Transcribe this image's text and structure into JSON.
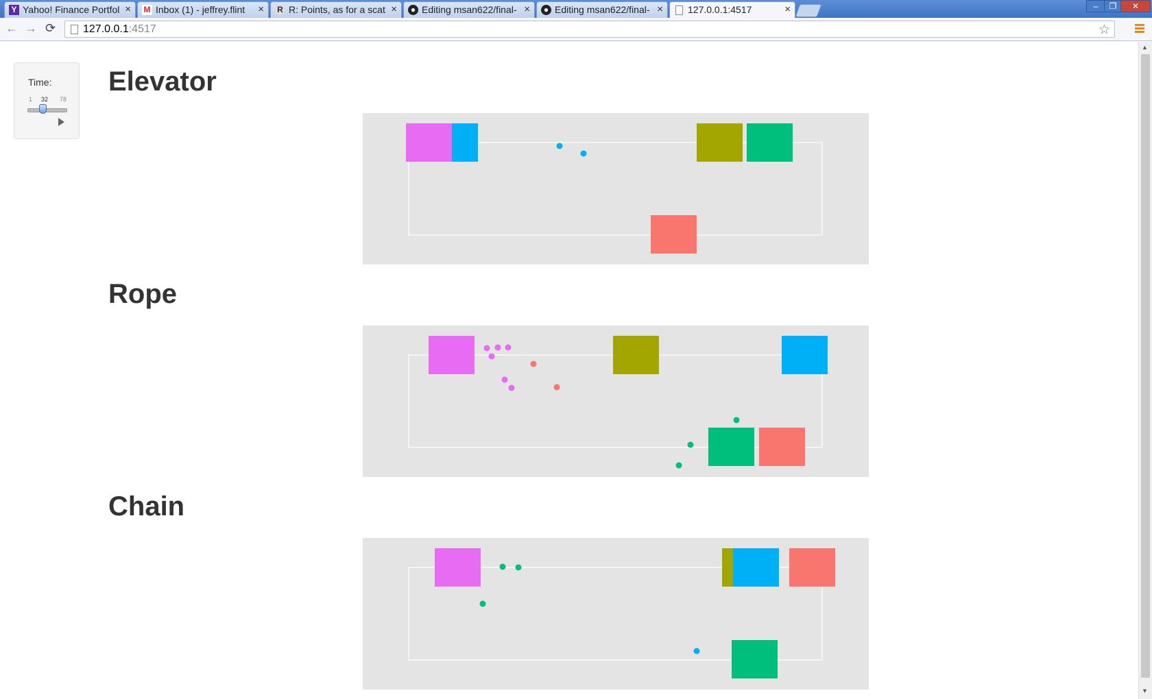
{
  "browser": {
    "tabs": [
      {
        "title": "Yahoo! Finance Portfol",
        "icon": "yahoo-icon",
        "active": false
      },
      {
        "title": "Inbox (1) - jeffrey.flint",
        "icon": "gmail-icon",
        "active": false
      },
      {
        "title": "R: Points, as for a scat",
        "icon": "r-icon",
        "active": false
      },
      {
        "title": "Editing msan622/final-",
        "icon": "github-icon",
        "active": false
      },
      {
        "title": "Editing msan622/final-",
        "icon": "github-icon",
        "active": false
      },
      {
        "title": "127.0.0.1:4517",
        "icon": "page-icon",
        "active": true
      }
    ],
    "url_host": "127.0.0.1",
    "url_port": ":4517"
  },
  "time_control": {
    "label": "Time:",
    "min": "1",
    "value": "32",
    "max": "78",
    "fraction": 0.4
  },
  "sections": [
    {
      "title": "Elevator",
      "boxes": [
        {
          "color": "#e76bf3",
          "col": 0,
          "row": 0
        },
        {
          "color": "#00b0f6",
          "col": 1,
          "row": 0,
          "partial": true
        },
        {
          "color": "#a3a500",
          "col": 6,
          "row": 0
        },
        {
          "color": "#00bf7d",
          "col": 7,
          "row": 0
        },
        {
          "color": "#f8766d",
          "col": 5,
          "row": 1
        }
      ],
      "dots": [
        {
          "color": "#00b0f6"
        },
        {
          "color": "#00b0f6"
        }
      ]
    },
    {
      "title": "Rope",
      "boxes": [
        {
          "color": "#e76bf3"
        },
        {
          "color": "#a3a500"
        },
        {
          "color": "#00b0f6"
        },
        {
          "color": "#00bf7d"
        },
        {
          "color": "#f8766d"
        }
      ],
      "dots": [
        {
          "color": "#e76bf3"
        },
        {
          "color": "#e76bf3"
        },
        {
          "color": "#e76bf3"
        },
        {
          "color": "#e76bf3"
        },
        {
          "color": "#e76bf3"
        },
        {
          "color": "#e76bf3"
        },
        {
          "color": "#f8766d"
        },
        {
          "color": "#f8766d"
        },
        {
          "color": "#00bf7d"
        },
        {
          "color": "#00bf7d"
        },
        {
          "color": "#00bf7d"
        }
      ]
    },
    {
      "title": "Chain",
      "boxes": [
        {
          "color": "#e76bf3"
        },
        {
          "color": "#a3a500"
        },
        {
          "color": "#00b0f6"
        },
        {
          "color": "#f8766d"
        },
        {
          "color": "#00bf7d"
        }
      ],
      "dots": [
        {
          "color": "#00bf7d"
        },
        {
          "color": "#00bf7d"
        },
        {
          "color": "#00bf7d"
        },
        {
          "color": "#00b0f6"
        }
      ]
    }
  ],
  "colors": {
    "panel_bg": "#e4e4e4",
    "track": "#ffffff",
    "accent_menu": "#e08a1e"
  }
}
